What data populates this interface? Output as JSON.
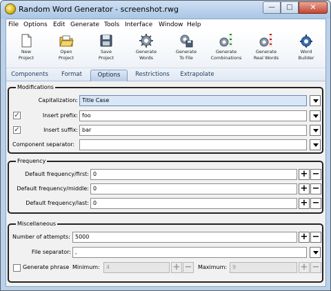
{
  "window": {
    "title": "Random Word Generator - screenshot.rwg"
  },
  "menu": [
    "File",
    "Options",
    "Edit",
    "Generate",
    "Tools",
    "Interface",
    "Window",
    "Help"
  ],
  "toolbar": [
    {
      "label": "New\nProject",
      "icon": "new-project-icon"
    },
    {
      "label": "Open\nProject",
      "icon": "open-project-icon"
    },
    {
      "label": "Save\nProject",
      "icon": "save-project-icon"
    },
    {
      "label": "Generate\nWords",
      "icon": "generate-words-icon"
    },
    {
      "label": "Generate\nTo File",
      "icon": "generate-to-file-icon"
    },
    {
      "label": "Generate\nCombinations",
      "icon": "generate-combinations-icon"
    },
    {
      "label": "Generate\nReal Words",
      "icon": "generate-real-words-icon"
    },
    {
      "label": "Word\nBuilder",
      "icon": "word-builder-icon"
    }
  ],
  "tabs": [
    "Components",
    "Format",
    "Options",
    "Restrictions",
    "Extrapolate"
  ],
  "active_tab": "Options",
  "modifications": {
    "title": "Modifications",
    "capitalization_label": "Capitalization:",
    "capitalization_value": "Title Case",
    "prefix_label": "Insert prefix:",
    "prefix_value": "foo",
    "prefix_checked": true,
    "suffix_label": "Insert suffix:",
    "suffix_value": "bar",
    "suffix_checked": true,
    "separator_label": "Component separator:",
    "separator_value": ""
  },
  "frequency": {
    "title": "Frequency",
    "first_label": "Default frequency/first:",
    "first_value": "0",
    "middle_label": "Default frequency/middle:",
    "middle_value": "0",
    "last_label": "Default frequency/last:",
    "last_value": "0"
  },
  "misc": {
    "title": "Miscellaneous",
    "attempts_label": "Number of attempts:",
    "attempts_value": "5000",
    "file_sep_label": "File separator:",
    "file_sep_value": ",",
    "phrase_label": "Generate phrase",
    "phrase_checked": false,
    "min_label": "Minimum:",
    "min_value": "4",
    "max_label": "Maximum:",
    "max_value": "9"
  },
  "buttons": {
    "plus": "+",
    "minus": "−",
    "check": "✓"
  },
  "window_controls": {
    "minimize": "—",
    "maximize": "□",
    "close": "✕"
  }
}
